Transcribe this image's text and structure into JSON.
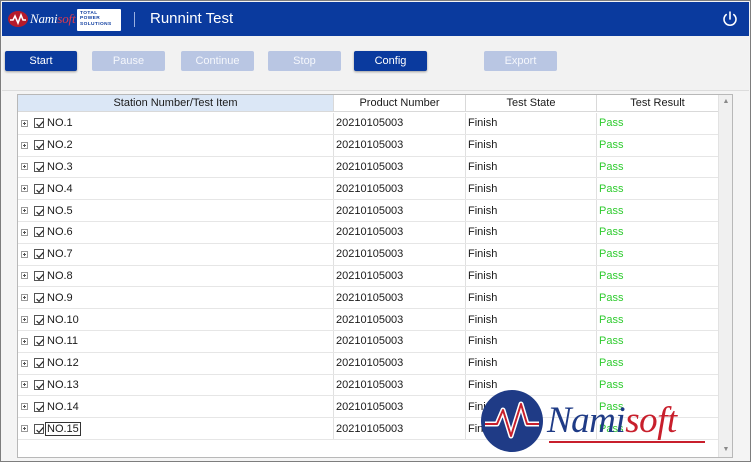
{
  "header": {
    "logo_name": "Namisoft",
    "logo_prefix": "Nami",
    "logo_suffix": "soft",
    "partner_lines": [
      "TOTAL",
      "POWER",
      "SOLUTIONS"
    ],
    "title": "Runnint Test",
    "power_icon": "power-icon",
    "bar_color": "#0a3a9e"
  },
  "toolbar": {
    "buttons": [
      {
        "label": "Start",
        "state": "active"
      },
      {
        "label": "Pause",
        "state": "disabled"
      },
      {
        "label": "Continue",
        "state": "disabled"
      },
      {
        "label": "Stop",
        "state": "disabled"
      },
      {
        "label": "Config",
        "state": "active"
      },
      {
        "label": "Export",
        "state": "disabled"
      }
    ]
  },
  "table": {
    "columns": [
      "Station Number/Test Item",
      "Product Number",
      "Test State",
      "Test Result"
    ],
    "rows": [
      {
        "station": "NO.1",
        "product": "20210105003",
        "state": "Finish",
        "result": "Pass"
      },
      {
        "station": "NO.2",
        "product": "20210105003",
        "state": "Finish",
        "result": "Pass"
      },
      {
        "station": "NO.3",
        "product": "20210105003",
        "state": "Finish",
        "result": "Pass"
      },
      {
        "station": "NO.4",
        "product": "20210105003",
        "state": "Finish",
        "result": "Pass"
      },
      {
        "station": "NO.5",
        "product": "20210105003",
        "state": "Finish",
        "result": "Pass"
      },
      {
        "station": "NO.6",
        "product": "20210105003",
        "state": "Finish",
        "result": "Pass"
      },
      {
        "station": "NO.7",
        "product": "20210105003",
        "state": "Finish",
        "result": "Pass"
      },
      {
        "station": "NO.8",
        "product": "20210105003",
        "state": "Finish",
        "result": "Pass"
      },
      {
        "station": "NO.9",
        "product": "20210105003",
        "state": "Finish",
        "result": "Pass"
      },
      {
        "station": "NO.10",
        "product": "20210105003",
        "state": "Finish",
        "result": "Pass"
      },
      {
        "station": "NO.11",
        "product": "20210105003",
        "state": "Finish",
        "result": "Pass"
      },
      {
        "station": "NO.12",
        "product": "20210105003",
        "state": "Finish",
        "result": "Pass"
      },
      {
        "station": "NO.13",
        "product": "20210105003",
        "state": "Finish",
        "result": "Pass"
      },
      {
        "station": "NO.14",
        "product": "20210105003",
        "state": "Finish",
        "result": "Pass"
      },
      {
        "station": "NO.15",
        "product": "20210105003",
        "state": "Finish",
        "result": "Pass"
      }
    ],
    "pass_color": "#2fcb2f"
  },
  "watermark": {
    "brand_prefix": "Nami",
    "brand_suffix": "soft",
    "colors": {
      "blue": "#1f3b86",
      "red": "#c81f2c"
    }
  }
}
